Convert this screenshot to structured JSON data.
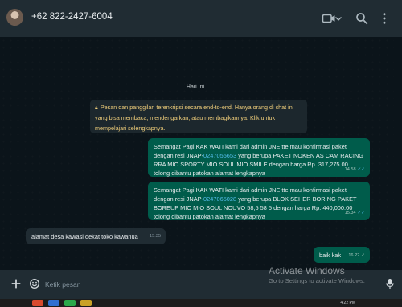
{
  "header": {
    "contact_name": "+62 822-2427-6004",
    "icons": [
      "video-call-icon",
      "chevron-down-icon",
      "search-icon",
      "menu-icon"
    ]
  },
  "chat": {
    "day_label": "Hari Ini",
    "system_message": "Pesan dan panggilan terenkripsi secara end-to-end. Hanya orang di chat ini yang bisa membaca, mendengarkan, atau membagikannya. Klik untuk mempelajari selengkapnya.",
    "messages": [
      {
        "direction": "out",
        "text_before_link": "Semangat Pagi KAK WATI kami dari admin JNE tte mau konfirmasi paket dengan resi JNAP-",
        "link": "0247055653",
        "text_after_link": " yang berupa PAKET NOKEN AS CAM RACING RRA MIO SPORTY MIO SOUL MIO SMILE dengan harga Rp. 317,275.00 tolong dibantu patokan alamat lengkapnya",
        "time": "14.58",
        "status": "read"
      },
      {
        "direction": "out",
        "text_before_link": "Semangat Pagi KAK WATI kami dari admin JNE tte mau konfirmasi paket dengan resi JNAP-",
        "link": "0247065028",
        "text_after_link": " yang berupa BLOK SEHER BORING PAKET BOREUP MIO MIO SOUL NOUVO 58,5 58 5 dengan harga Rp. 440,000.00 tolong dibantu patokan alamat lengkapnya",
        "time": "15.34",
        "status": "read"
      },
      {
        "direction": "in",
        "text": "alamat desa kawasi dekat toko kawanua",
        "time": "15.35"
      },
      {
        "direction": "out",
        "text": "baik kak",
        "time": "16.22",
        "status": "delivered"
      }
    ]
  },
  "footer": {
    "input_placeholder": "Ketik pesan",
    "icons": [
      "plus-icon",
      "sticker-icon",
      "microphone-icon"
    ]
  },
  "overlay": {
    "activate_title": "Activate Windows",
    "activate_subtitle": "Go to Settings to activate Windows."
  },
  "taskbar": {
    "time": "4:22 PM"
  },
  "colors": {
    "outgoing_bubble": "#005c4b",
    "incoming_bubble": "#202c33",
    "link": "#53bdeb",
    "system_text": "#f1cf7b",
    "background": "#0b141a"
  }
}
